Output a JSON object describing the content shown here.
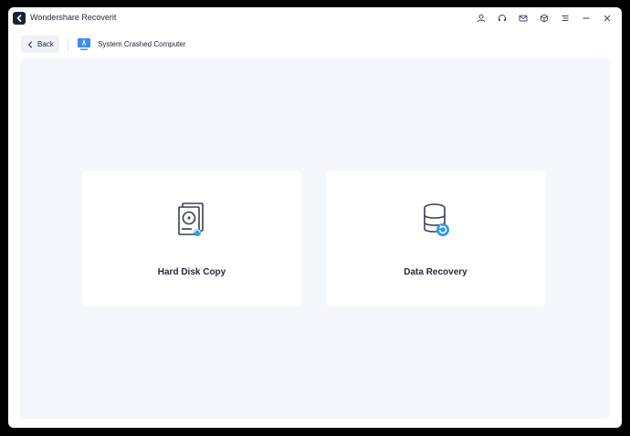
{
  "app": {
    "title": "Wondershare Recoverit"
  },
  "titlebar_icons": [
    "user-icon",
    "headset-icon",
    "mail-icon",
    "cube-icon",
    "menu-icon",
    "minimize-icon",
    "close-icon"
  ],
  "nav": {
    "back_label": "Back",
    "breadcrumb": "System Crashed Computer"
  },
  "options": [
    {
      "label": "Hard Disk Copy",
      "icon": "hard-disk-copy-icon"
    },
    {
      "label": "Data Recovery",
      "icon": "data-recovery-icon"
    }
  ],
  "colors": {
    "accent": "#2f9bf0",
    "background": "#f4f7fc",
    "card": "#ffffff",
    "text": "#1f2430"
  }
}
